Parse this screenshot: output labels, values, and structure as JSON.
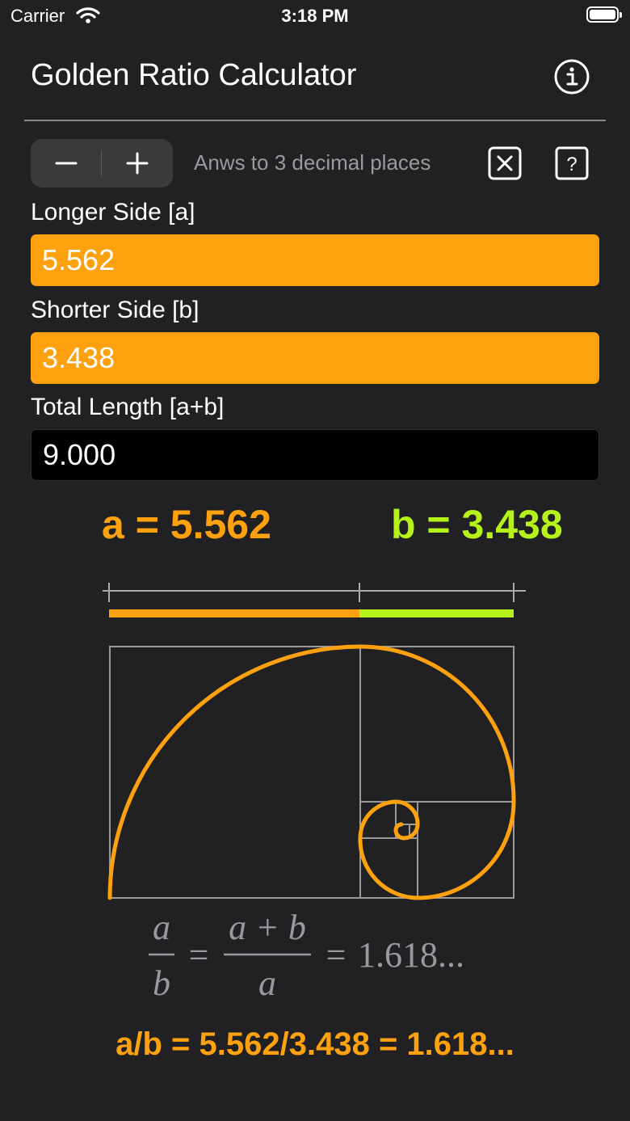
{
  "status_bar": {
    "carrier": "Carrier",
    "time": "3:18 PM"
  },
  "header": {
    "title": "Golden Ratio Calculator"
  },
  "toolbar": {
    "decimal_text": "Anws to 3 decimal places"
  },
  "inputs": {
    "longer_label": "Longer Side [a]",
    "longer_value": "5.562",
    "shorter_label": "Shorter Side [b]",
    "shorter_value": "3.438",
    "total_label": "Total Length [a+b]",
    "total_value": "9.000"
  },
  "results": {
    "a_text": "a = 5.562",
    "b_text": "b = 3.438",
    "ratio_text": "a/b = 5.562/3.438 = 1.618..."
  },
  "formula": {
    "left_num": "a",
    "left_den": "b",
    "right_num": "a + b",
    "right_den": "a",
    "equals": "=",
    "value": "1.618..."
  },
  "colors": {
    "accent_orange": "#fea10f",
    "accent_green": "#b5f21a",
    "background": "#212123"
  },
  "icons": [
    "wifi-icon",
    "battery-icon",
    "info-icon",
    "minus-icon",
    "plus-icon",
    "clear-icon",
    "help-icon"
  ]
}
